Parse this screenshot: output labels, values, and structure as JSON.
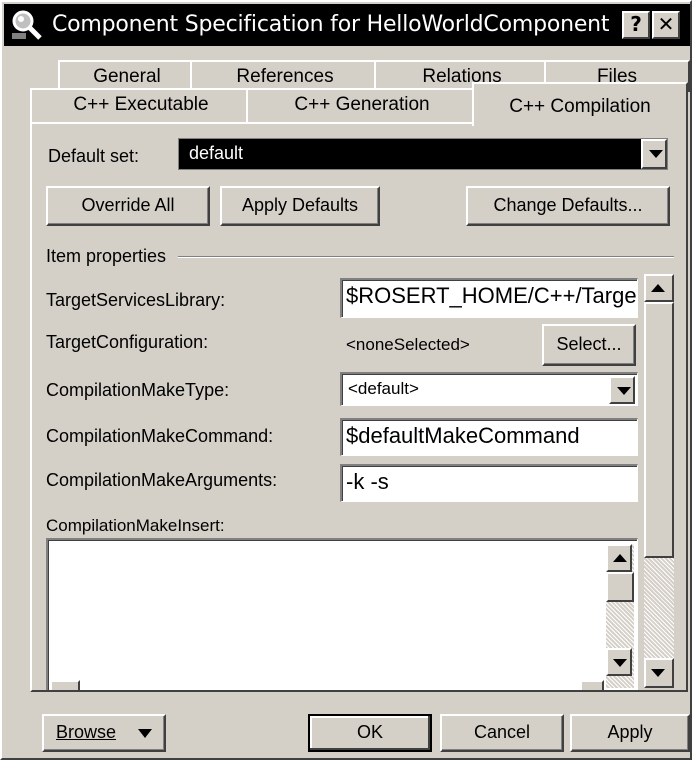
{
  "window": {
    "title": "Component Specification for HelloWorldComponent",
    "help_label": "?",
    "close_label": "✕"
  },
  "tabs": {
    "back_row": [
      "General",
      "References",
      "Relations",
      "Files"
    ],
    "front_row": [
      "C++ Executable",
      "C++ Generation",
      "C++ Compilation"
    ],
    "active": "C++ Compilation"
  },
  "default_set": {
    "label": "Default set:",
    "value": "default"
  },
  "buttons": {
    "override_all": "Override All",
    "apply_defaults": "Apply Defaults",
    "change_defaults": "Change Defaults...",
    "select": "Select...",
    "browse": "Browse",
    "ok": "OK",
    "cancel": "Cancel",
    "apply": "Apply"
  },
  "item_properties": {
    "group_label": "Item properties",
    "target_services_library": {
      "label": "TargetServicesLibrary:",
      "value": "$ROSERT_HOME/C++/TargetRTS"
    },
    "target_configuration": {
      "label": "TargetConfiguration:",
      "value": "<noneSelected>"
    },
    "compilation_make_type": {
      "label": "CompilationMakeType:",
      "value": "<default>"
    },
    "compilation_make_command": {
      "label": "CompilationMakeCommand:",
      "value": "$defaultMakeCommand"
    },
    "compilation_make_arguments": {
      "label": "CompilationMakeArguments:",
      "value": "-k -s"
    },
    "compilation_make_insert": {
      "label": "CompilationMakeInsert:",
      "value": ""
    }
  },
  "icons": {
    "app": "magnifier-icon",
    "dropdown": "chevron-down-icon",
    "scroll_up": "arrow-up-icon",
    "scroll_down": "arrow-down-icon"
  },
  "colors": {
    "face": "#d4d0c8",
    "titlebar": "#000000",
    "selection": "#000000"
  }
}
